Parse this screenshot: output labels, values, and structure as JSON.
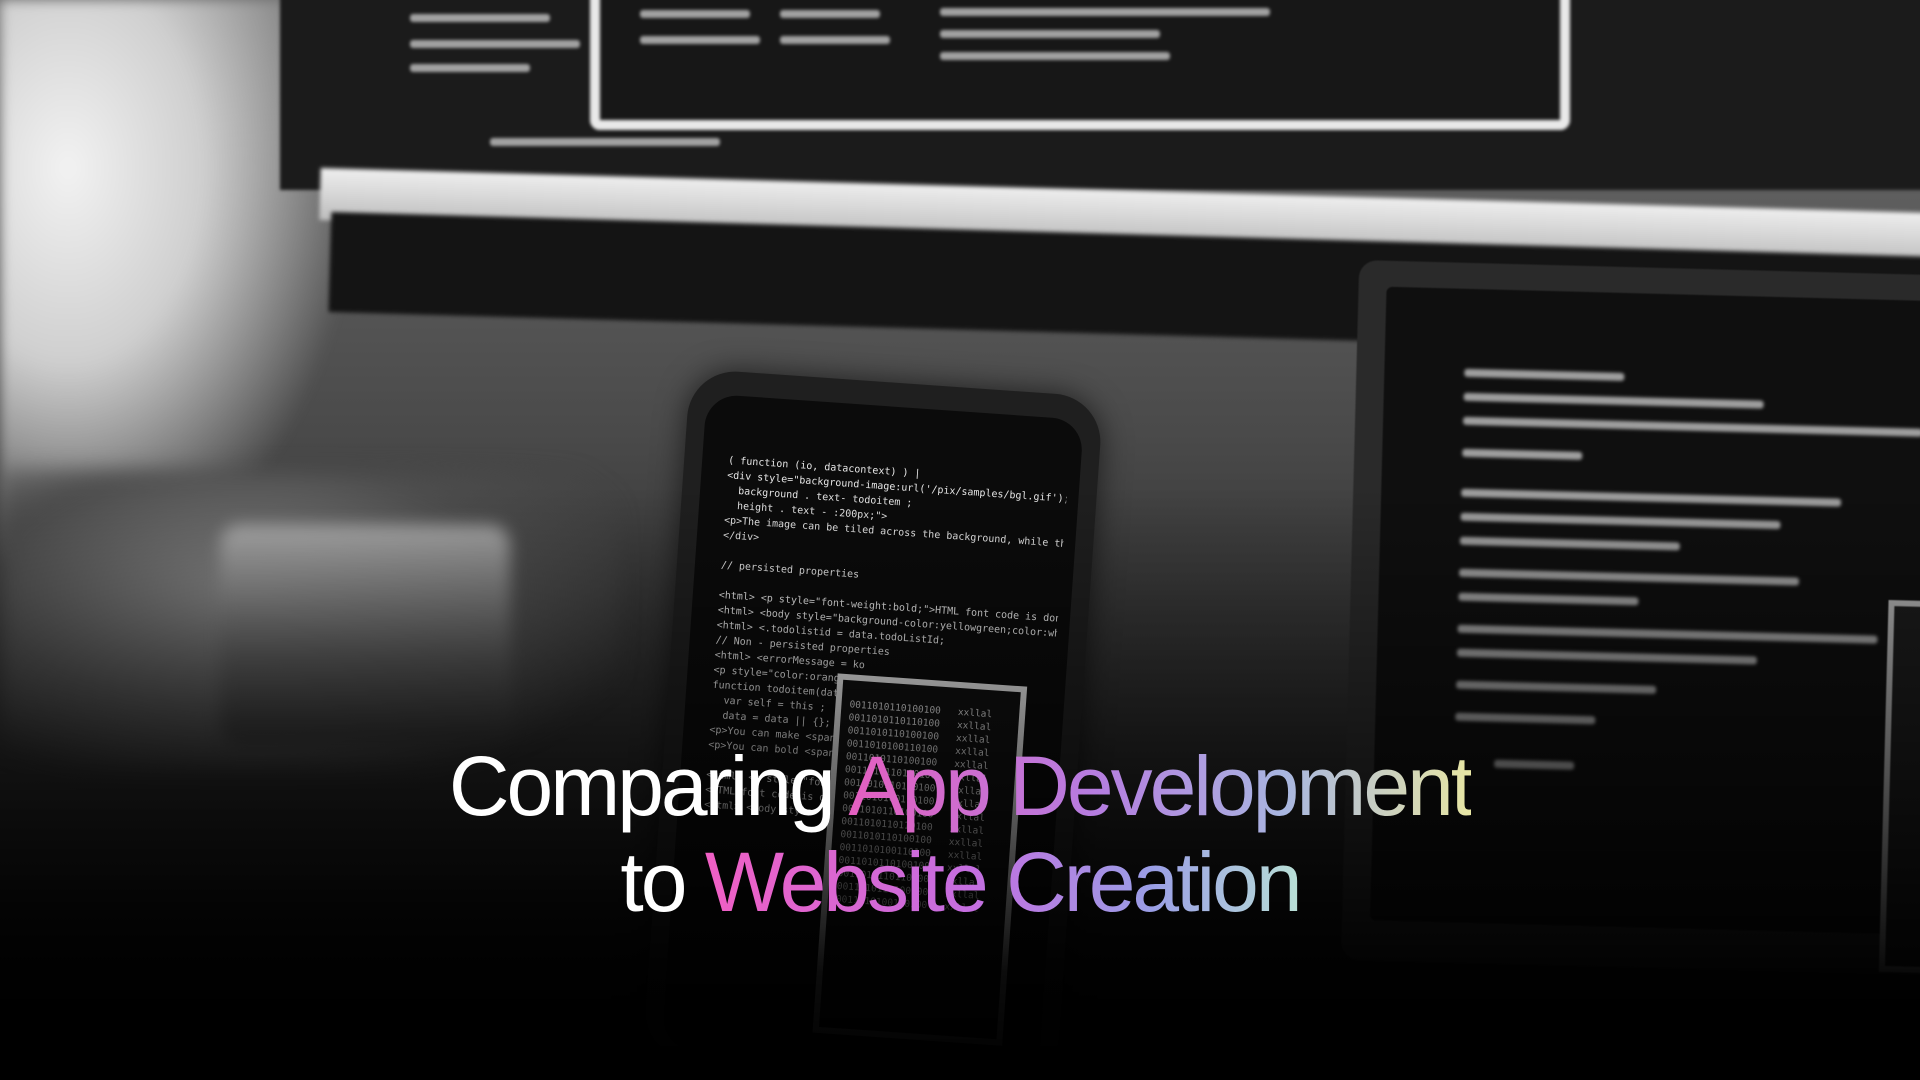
{
  "headline": {
    "line1_plain": "Comparing ",
    "line1_highlight": "App Development",
    "line2_plain": "to ",
    "line2_highlight": "Website Creation"
  },
  "phone_code": [
    "( function (io, datacontext) ) |",
    "<div style=\"background-image:url('/pix/samples/bgl.gif');",
    "  background . text- todoitem ;",
    "  height . text - :200px;\">",
    "<p>The image can be tiled across the background, while the te",
    "</div>",
    "",
    "// persisted properties",
    "",
    "<html> <p style=\"font-weight:bold;\">HTML font code is done usi",
    "<html> <body style=\"background-color:yellowgreen;color:white",
    "<html> <.todolistid = data.todoListId;",
    "// Non - persisted properties",
    "<html> <errorMessage = ko",
    "<p style=\"color:orange;\">HTM",
    "function todoitem(data) {",
    "  var self = this ;",
    "  data = data || {};",
    "<p>You can make <span style",
    "<p>You can bold <span style",
    "",
    "<html> <p style=\"font-weight",
    "<HTML font code is done usin",
    "<html> <body style"
  ],
  "phone_binary": [
    "0011010110100100   xxllal",
    "0011010110110100   xxllal",
    "0011010110100100   xxllal",
    "0011010100110100   xxllal",
    "0011010110100100   xxllal",
    "0011010110110100   xxllal",
    "0011010110100100   xxllal",
    "0011010100110100   xxllal",
    "0011010110100100   xxllal",
    "0011010110110100   xxllal",
    "0011010110100100   xxllal",
    "0011010100110100   xxllal",
    "0011010110100100   xxllal",
    "0011010110110100   xxllal",
    "0011010110100100   xxllal",
    "0011010100110100   xxllal"
  ],
  "colors": {
    "gradient_start": "#e45fc0",
    "gradient_mid": "#b57de0",
    "gradient_end": "#e8e6a4"
  }
}
